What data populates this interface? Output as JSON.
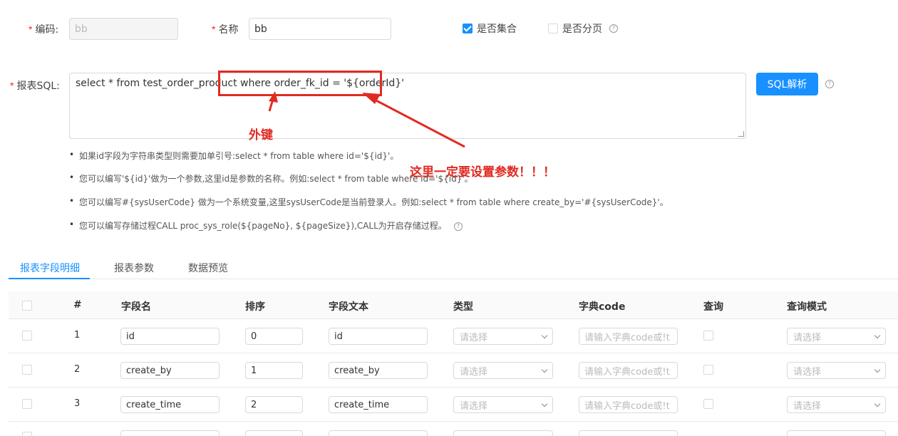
{
  "form": {
    "code_label": "编码:",
    "code_value": "bb",
    "name_label": "名称",
    "name_value": "bb",
    "is_collection_label": "是否集合",
    "is_collection_checked": true,
    "is_paged_label": "是否分页",
    "is_paged_checked": false,
    "sql_label": "报表SQL:",
    "sql_value": "select * from test_order_product where order_fk_id = '${orderId}'",
    "sql_parse_button": "SQL解析",
    "help_glyph": "?",
    "required_mark": "*"
  },
  "tips": [
    "如果id字段为字符串类型则需要加单引号:select * from table where id='${id}'。",
    "您可以编写'${id}'做为一个参数,这里id是参数的名称。例如:select * from table where id='${id}'。",
    "您可以编写#{sysUserCode} 做为一个系统变量,这里sysUserCode是当前登录人。例如:select * from table where create_by='#{sysUserCode}'。",
    "您可以编写存储过程CALL proc_sys_role(${pageNo}, ${pageSize}),CALL为开启存储过程。"
  ],
  "annotations": {
    "foreign_key": "外键",
    "must_set_param": "这里一定要设置参数！！！",
    "color": "#e12b22"
  },
  "tabs": [
    {
      "label": "报表字段明细",
      "active": true
    },
    {
      "label": "报表参数",
      "active": false
    },
    {
      "label": "数据预览",
      "active": false
    }
  ],
  "table": {
    "headers": [
      "#",
      "字段名",
      "排序",
      "字段文本",
      "类型",
      "字典code",
      "查询",
      "查询模式"
    ],
    "type_placeholder": "请选择",
    "dict_placeholder": "请输入字典code或!t",
    "mode_placeholder": "请选择",
    "rows": [
      {
        "index": "1",
        "field": "id",
        "order": "0",
        "text": "id"
      },
      {
        "index": "2",
        "field": "create_by",
        "order": "1",
        "text": "create_by"
      },
      {
        "index": "3",
        "field": "create_time",
        "order": "2",
        "text": "create_time"
      }
    ]
  },
  "colors": {
    "primary": "#1890ff",
    "required": "#f5222d"
  }
}
